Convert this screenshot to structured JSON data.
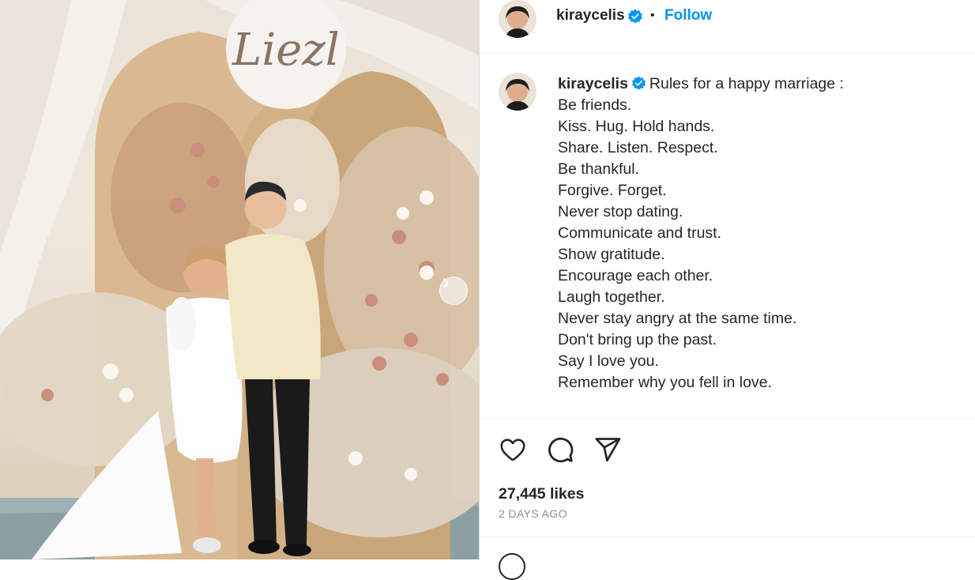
{
  "post": {
    "username": "kiraycelis",
    "separator": "•",
    "follow_label": "Follow",
    "caption_lead": "Rules for a happy marriage :",
    "caption_lines": [
      "Be friends.",
      "Kiss. Hug. Hold hands.",
      "Share. Listen. Respect.",
      "Be thankful.",
      "Forgive. Forget.",
      "Never stop dating.",
      "Communicate and trust.",
      "Show gratitude.",
      "Encourage each other.",
      "Laugh together.",
      "Never stay angry at the same time.",
      "Don't bring up the past.",
      "Say I love you.",
      "Remember why you fell in love."
    ],
    "likes": "27,445 likes",
    "date": "2 DAYS AGO"
  },
  "photo": {
    "sign_text": "Liezl"
  },
  "colors": {
    "accent": "#0095f6",
    "text": "#262626",
    "muted": "#8e8e8e",
    "divider": "#dbdbdb"
  },
  "icons": [
    "verified-badge-icon",
    "heart-icon",
    "comment-icon",
    "share-icon",
    "chevron-right-icon"
  ]
}
